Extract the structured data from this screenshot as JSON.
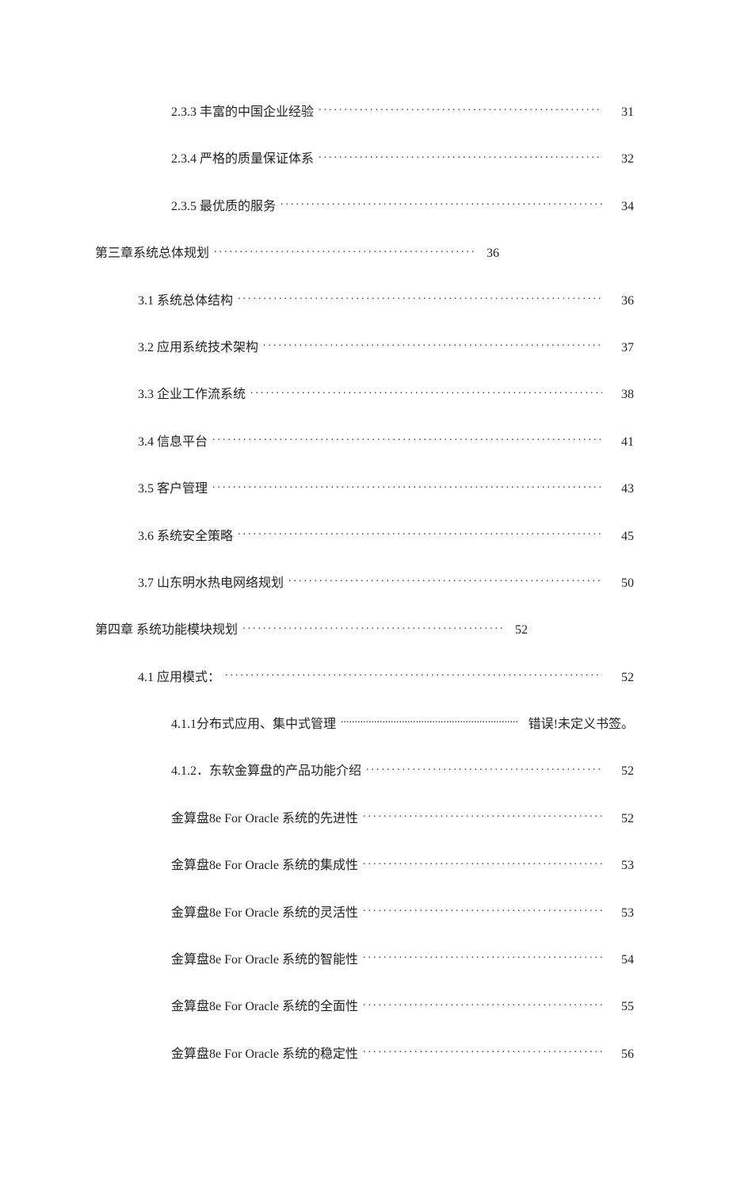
{
  "toc": [
    {
      "kind": "entry",
      "indent": 2,
      "label": "2.3.3 丰富的中国企业经验",
      "page": "31"
    },
    {
      "kind": "entry",
      "indent": 2,
      "label": "2.3.4 严格的质量保证体系",
      "page": "32"
    },
    {
      "kind": "entry",
      "indent": 2,
      "label": "2.3.5 最优质的服务",
      "page": "34"
    },
    {
      "kind": "chapter",
      "indent": 0,
      "label": "第三章系统总体规划",
      "page": "36"
    },
    {
      "kind": "entry",
      "indent": 1,
      "label": "3.1 系统总体结构",
      "page": "36"
    },
    {
      "kind": "entry",
      "indent": 1,
      "label": "3.2 应用系统技术架构",
      "page": "37"
    },
    {
      "kind": "entry",
      "indent": 1,
      "label": "3.3 企业工作流系统",
      "page": "38"
    },
    {
      "kind": "entry",
      "indent": 1,
      "label": "3.4 信息平台",
      "page": "41"
    },
    {
      "kind": "entry",
      "indent": 1,
      "label": "3.5 客户管理",
      "page": "43"
    },
    {
      "kind": "entry",
      "indent": 1,
      "label": "3.6 系统安全策略",
      "page": "45"
    },
    {
      "kind": "entry",
      "indent": 1,
      "label": "3.7 山东明水热电网络规划",
      "page": "50"
    },
    {
      "kind": "chapter",
      "indent": 0,
      "label": "第四章 系统功能模块规划",
      "page": "52"
    },
    {
      "kind": "entry",
      "indent": 1,
      "label": "4.1 应用模式：",
      "page": "52"
    },
    {
      "kind": "error",
      "indent": 2,
      "label": "4.1.1分布式应用、集中式管理",
      "page": "错误!未定义书签。"
    },
    {
      "kind": "entry",
      "indent": 2,
      "label": "4.1.2．东软金算盘的产品功能介绍",
      "page": "52"
    },
    {
      "kind": "entry",
      "indent": 2,
      "label": "金算盘8e For Oracle   系统的先进性",
      "page": "52"
    },
    {
      "kind": "entry",
      "indent": 2,
      "label": "金算盘8e For Oracle 系统的集成性",
      "page": "53"
    },
    {
      "kind": "entry",
      "indent": 2,
      "label": "金算盘8e For Oracle   系统的灵活性",
      "page": "53"
    },
    {
      "kind": "entry",
      "indent": 2,
      "label": "金算盘8e For Oracle   系统的智能性",
      "page": "54"
    },
    {
      "kind": "entry",
      "indent": 2,
      "label": "金算盘8e For Oracle   系统的全面性",
      "page": "55"
    },
    {
      "kind": "entry",
      "indent": 2,
      "label": "金算盘8e For Oracle 系统的稳定性",
      "page": "56"
    }
  ]
}
